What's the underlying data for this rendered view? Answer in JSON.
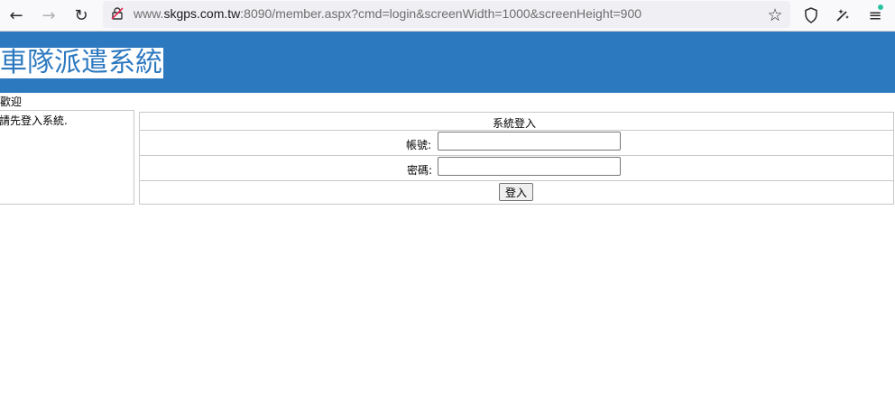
{
  "browser": {
    "url_prefix": "www.",
    "url_host": "skgps.com.tw",
    "url_rest": ":8090/member.aspx?cmd=login&screenWidth=1000&screenHeight=900",
    "back_glyph": "←",
    "forward_glyph": "→",
    "reload_glyph": "↻",
    "bookmark_glyph": "☆",
    "menu_glyph": "≡"
  },
  "page": {
    "site_title": "車隊派遣系統",
    "welcome": "歡迎",
    "prompt": "請先登入系統.",
    "login": {
      "heading": "系統登入",
      "account_label": "帳號:",
      "account_value": "",
      "password_label": "密碼:",
      "password_value": "",
      "submit_label": "登入"
    }
  },
  "colors": {
    "banner": "#2d79c0",
    "border": "#c8c8c8"
  }
}
